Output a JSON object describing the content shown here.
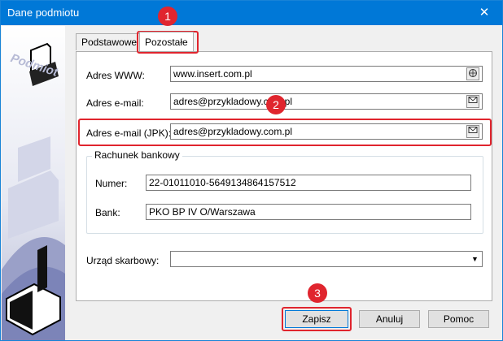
{
  "window": {
    "title": "Dane podmiotu",
    "close_glyph": "✕"
  },
  "sidebar": {
    "watermark": "Podmiot",
    "icon": "printer-building-icon"
  },
  "tabs": [
    {
      "label": "Podstawowe",
      "active": false
    },
    {
      "label": "Pozostałe",
      "active": true
    }
  ],
  "form": {
    "www": {
      "label": "Adres WWW:",
      "value": "www.insert.com.pl",
      "btn_icon": "globe-icon"
    },
    "email": {
      "label": "Adres e-mail:",
      "value": "adres@przykladowy.com.pl",
      "btn_icon": "mail-icon"
    },
    "email_jpk": {
      "label": "Adres e-mail (JPK):",
      "value": "adres@przykladowy.com.pl",
      "btn_icon": "mail-icon"
    },
    "bank_group": {
      "legend": "Rachunek bankowy",
      "numer": {
        "label": "Numer:",
        "value": "22-01011010-5649134864157512"
      },
      "bank": {
        "label": "Bank:",
        "value": "PKO BP IV O/Warszawa"
      }
    },
    "urzad": {
      "label": "Urząd skarbowy:",
      "value": "",
      "arrow": "▼"
    }
  },
  "buttons": {
    "save": "Zapisz",
    "cancel": "Anuluj",
    "help": "Pomoc"
  },
  "annotations": {
    "badge1": "1",
    "badge2": "2",
    "badge3": "3",
    "color": "#e0252e"
  }
}
